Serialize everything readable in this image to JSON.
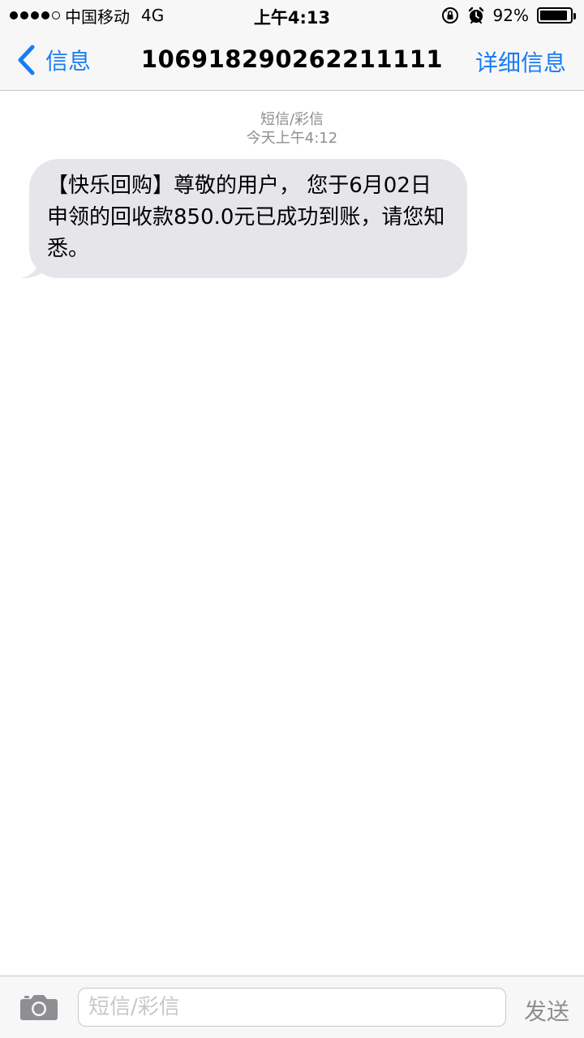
{
  "status_bar": {
    "carrier": "中国移动",
    "network": "4G",
    "time": "上午4:13",
    "battery_percent": "92%",
    "battery_level": 0.92,
    "signal_bars_filled": 4,
    "signal_bars_total": 5
  },
  "nav": {
    "back_label": "信息",
    "title": "106918290262211111",
    "details_label": "详细信息"
  },
  "thread": {
    "message_type": "短信/彩信",
    "timestamp": "今天上午4:12",
    "messages": [
      {
        "direction": "incoming",
        "text": "【快乐回购】尊敬的用户， 您于6月02日 申领的回收款850.0元已成功到账，请您知悉。"
      }
    ]
  },
  "composer": {
    "placeholder": "短信/彩信",
    "value": "",
    "send_label": "发送"
  },
  "colors": {
    "accent": "#1a7cf4",
    "bubble_incoming": "#e5e5ea",
    "secondary_text": "#8e8e93",
    "bar_background": "#f7f7f7"
  },
  "icons": {
    "back": "chevron-left-icon",
    "camera": "camera-icon",
    "orientation_lock": "orientation-lock-icon",
    "alarm": "alarm-icon",
    "battery": "battery-icon"
  }
}
